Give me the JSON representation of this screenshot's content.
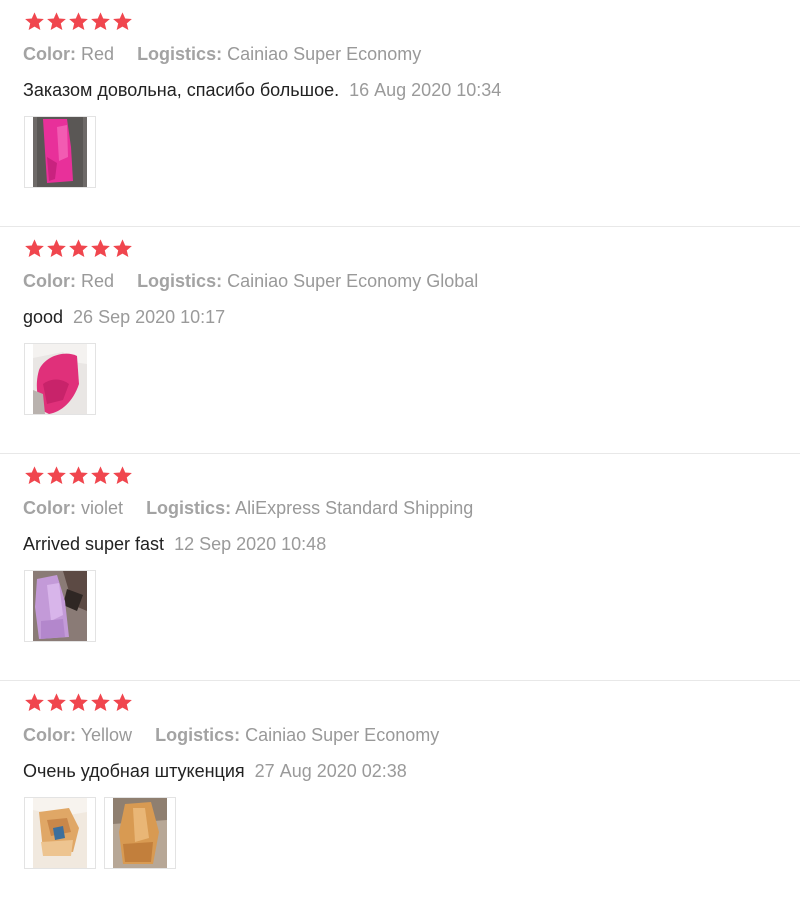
{
  "reviews": [
    {
      "rating": 5,
      "color_label": "Color:",
      "color_value": "Red",
      "logistics_label": "Logistics:",
      "logistics_value": "Cainiao Super Economy",
      "text": "Заказом довольна, спасибо большое.",
      "date": "16 Aug 2020 10:34",
      "photos": 1
    },
    {
      "rating": 5,
      "color_label": "Color:",
      "color_value": "Red",
      "logistics_label": "Logistics:",
      "logistics_value": "Cainiao Super Economy Global",
      "text": "good",
      "date": "26 Sep 2020 10:17",
      "photos": 1
    },
    {
      "rating": 5,
      "color_label": "Color:",
      "color_value": "violet",
      "logistics_label": "Logistics:",
      "logistics_value": "AliExpress Standard Shipping",
      "text": "Arrived super fast",
      "date": "12 Sep 2020 10:48",
      "photos": 1
    },
    {
      "rating": 5,
      "color_label": "Color:",
      "color_value": "Yellow",
      "logistics_label": "Logistics:",
      "logistics_value": "Cainiao Super Economy",
      "text": "Очень удобная штукенция",
      "date": "27 Aug 2020 02:38",
      "photos": 2
    }
  ],
  "colors": {
    "star": "#f0464e",
    "label": "#a3a3a3",
    "text": "#222222",
    "date": "#9a9a9a"
  }
}
